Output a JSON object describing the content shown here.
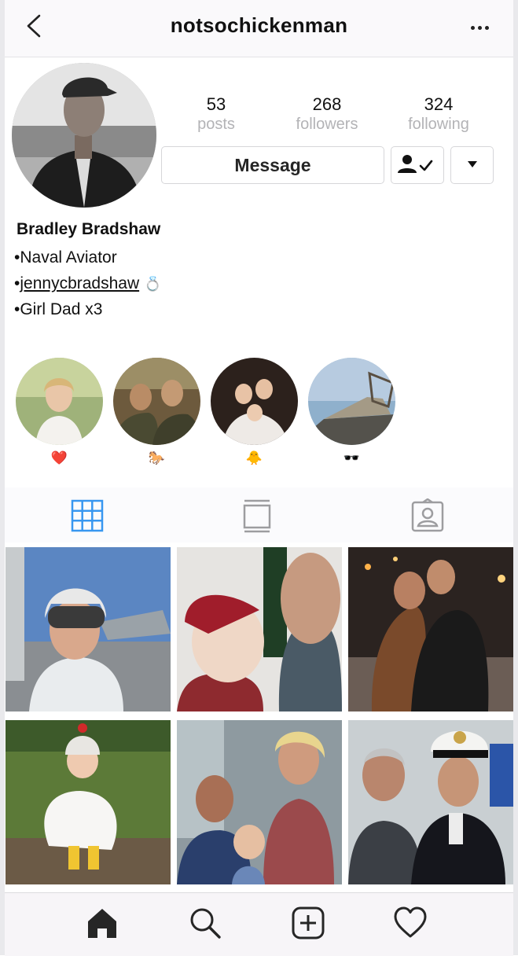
{
  "header": {
    "username": "notsochickenman",
    "back_icon": "chevron-left-icon",
    "more_icon": "more-horizontal-icon"
  },
  "profile": {
    "stats": [
      {
        "value": "53",
        "label": "posts"
      },
      {
        "value": "268",
        "label": "followers"
      },
      {
        "value": "324",
        "label": "following"
      }
    ],
    "message_label": "Message",
    "following_icon": "person-check-icon",
    "dropdown_icon": "caret-down-icon",
    "full_name": "Bradley Bradshaw",
    "bio": {
      "line1": "•Naval Aviator",
      "line2_prefix": "•",
      "line2_link": "jennycbradshaw",
      "line2_emoji": "💍",
      "line3": "•Girl Dad x3"
    }
  },
  "highlights": [
    {
      "emoji": "❤️",
      "icon": "heart-emoji"
    },
    {
      "emoji": "🐎",
      "icon": "horse-emoji"
    },
    {
      "emoji": "🐥",
      "icon": "chick-emoji"
    },
    {
      "emoji": "🕶️",
      "icon": "sunglasses-emoji"
    }
  ],
  "tabs": [
    "grid-icon",
    "feed-icon",
    "tagged-icon"
  ],
  "nav": [
    "home-icon",
    "search-icon",
    "add-icon",
    "heart-icon"
  ],
  "colors": {
    "accent_blue": "#3897f0",
    "muted_text": "#b3b3b6",
    "border": "#d6d6d9"
  }
}
